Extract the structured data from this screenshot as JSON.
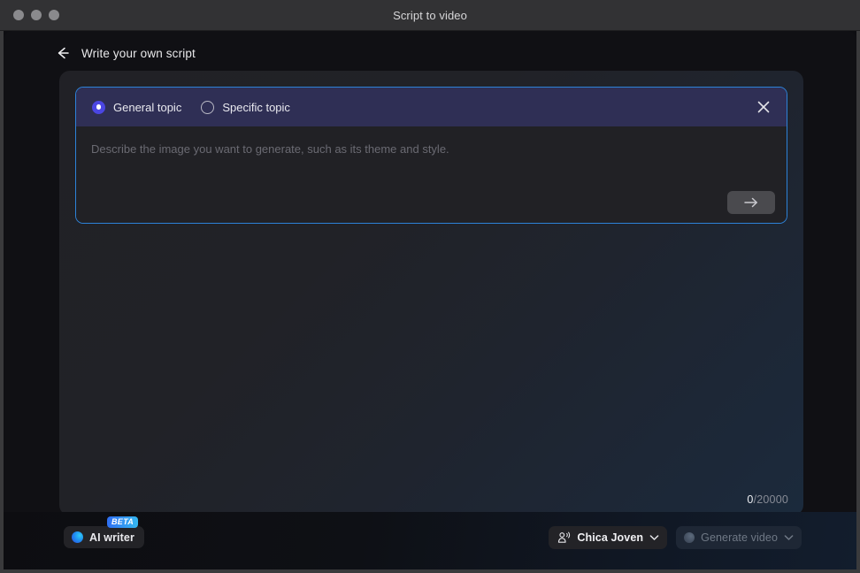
{
  "window": {
    "title": "Script to video",
    "traffic_lights": [
      "close-button",
      "minimize-button",
      "maximize-button"
    ]
  },
  "topnav": {
    "back_icon": "arrow-left-icon",
    "title": "Write your own script"
  },
  "prompt_panel": {
    "border_color": "#2d82d8",
    "header_bg": "#2f2f55",
    "radio_options": [
      {
        "label": "General topic",
        "selected": true
      },
      {
        "label": "Specific topic",
        "selected": false
      }
    ],
    "close_icon": "close-icon",
    "placeholder": "Describe the image you want to generate, such as its theme and style.",
    "value": "",
    "submit_icon": "arrow-right-icon"
  },
  "char_counter": {
    "current": "0",
    "max": "/20000"
  },
  "footer": {
    "ai_writer": {
      "label": "AI writer",
      "badge": "BETA",
      "icon": "ai-orb-icon"
    },
    "voice_select": {
      "icon": "voice-person-icon",
      "label": "Chica Joven",
      "chevron": "chevron-down-icon"
    },
    "generate": {
      "icon": "generate-orb-icon",
      "label": "Generate video",
      "chevron": "chevron-down-icon",
      "disabled": true
    }
  },
  "colors": {
    "accent_blue": "#2d82d8",
    "radio_selected": "#4b46e2",
    "beta_gradient_start": "#2f6df2",
    "beta_gradient_end": "#35b9f0",
    "titlebar_bg": "#323234",
    "card_bg_start": "#212126",
    "card_bg_end": "#1b2a3c"
  }
}
